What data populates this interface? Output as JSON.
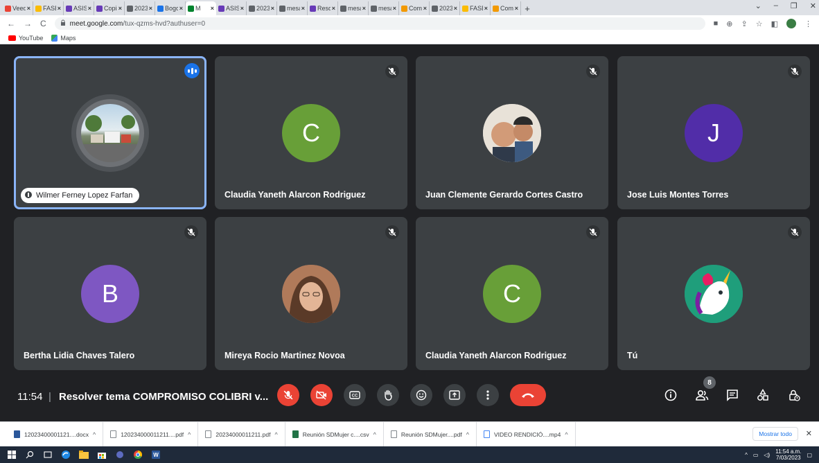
{
  "browser": {
    "tabs": [
      {
        "label": "Veedo",
        "icon_color": "#ea4335",
        "active": false
      },
      {
        "label": "FASE I",
        "icon_color": "#fbbc04",
        "active": false
      },
      {
        "label": "ASIST",
        "icon_color": "#673ab7",
        "active": false
      },
      {
        "label": "Copia",
        "icon_color": "#673ab7",
        "active": false
      },
      {
        "label": "2023",
        "icon_color": "#5f6368",
        "active": false
      },
      {
        "label": "Bogot",
        "icon_color": "#1a73e8",
        "active": false
      },
      {
        "label": "M",
        "icon_color": "#00832d",
        "active": true
      },
      {
        "label": "ASIST",
        "icon_color": "#673ab7",
        "active": false
      },
      {
        "label": "2023",
        "icon_color": "#5f6368",
        "active": false
      },
      {
        "label": "mesa",
        "icon_color": "#5f6368",
        "active": false
      },
      {
        "label": "Resol",
        "icon_color": "#673ab7",
        "active": false
      },
      {
        "label": "mesa",
        "icon_color": "#5f6368",
        "active": false
      },
      {
        "label": "mesa",
        "icon_color": "#5f6368",
        "active": false
      },
      {
        "label": "Comp",
        "icon_color": "#f29900",
        "active": false
      },
      {
        "label": "2023",
        "icon_color": "#5f6368",
        "active": false
      },
      {
        "label": "FASE I",
        "icon_color": "#fbbc04",
        "active": false
      },
      {
        "label": "Comp",
        "icon_color": "#f29900",
        "active": false
      }
    ],
    "url_domain": "meet.google.com",
    "url_path": "/tux-qzms-hvd?authuser=0",
    "bookmarks": [
      {
        "label": "YouTube",
        "icon": "youtube-icon"
      },
      {
        "label": "Maps",
        "icon": "maps-icon"
      }
    ]
  },
  "meet": {
    "participants": [
      {
        "name": "Wilmer Ferney Lopez Farfan",
        "avatar_type": "photo",
        "status": "speaking"
      },
      {
        "name": "Claudia Yaneth Alarcon Rodriguez",
        "avatar_type": "letter",
        "letter": "C",
        "color": "#689f38",
        "status": "muted"
      },
      {
        "name": "Juan Clemente Gerardo Cortes Castro",
        "avatar_type": "photo",
        "status": "muted"
      },
      {
        "name": "Jose Luis Montes Torres",
        "avatar_type": "letter",
        "letter": "J",
        "color": "#512da8",
        "status": "muted"
      },
      {
        "name": "Bertha Lidia Chaves Talero",
        "avatar_type": "letter",
        "letter": "B",
        "color": "#7e57c2",
        "status": "muted"
      },
      {
        "name": "Mireya Rocio Martinez Novoa",
        "avatar_type": "photo",
        "status": "muted"
      },
      {
        "name": "Claudia Yaneth Alarcon Rodriguez",
        "avatar_type": "letter",
        "letter": "C",
        "color": "#689f38",
        "status": "muted"
      },
      {
        "name": "Tú",
        "avatar_type": "photo",
        "status": "muted"
      }
    ],
    "time": "11:54",
    "title": "Resolver tema COMPROMISO COLIBRI v...",
    "participant_count": "8",
    "colors": {
      "danger": "#ea4335",
      "speaking_outline": "#8ab4f8",
      "tile_bg": "#3c4043",
      "page_bg": "#202124"
    }
  },
  "downloads": {
    "items": [
      {
        "name": "12023400001121....docx",
        "type": "word"
      },
      {
        "name": "120234000011211....pdf",
        "type": "pdf"
      },
      {
        "name": "20234000011211.pdf",
        "type": "pdf"
      },
      {
        "name": "Reunión SDMujer c....csv",
        "type": "excel"
      },
      {
        "name": "Reunión SDMujer....pdf",
        "type": "pdf"
      },
      {
        "name": "VIDEO RENDICIÓ....mp4",
        "type": "video"
      }
    ],
    "show_all": "Mostrar todo"
  },
  "taskbar": {
    "time": "11:54 a.m.",
    "date": "7/03/2023"
  }
}
